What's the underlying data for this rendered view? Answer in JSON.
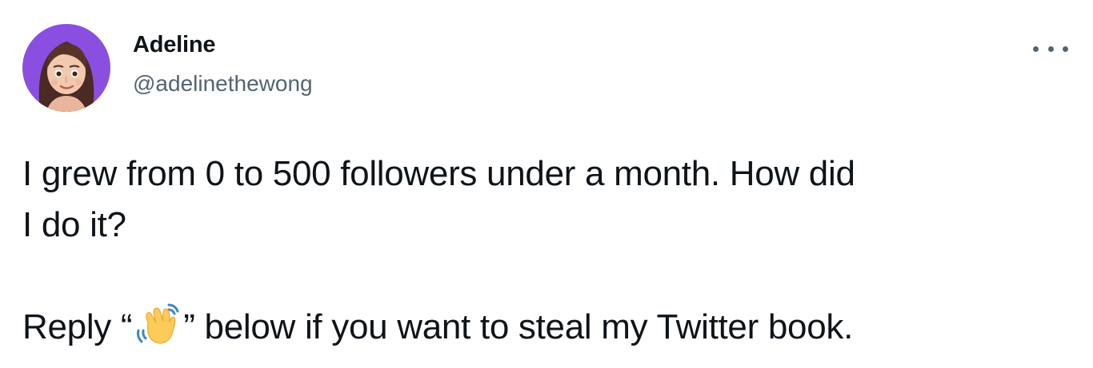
{
  "tweet": {
    "display_name": "Adeline",
    "handle": "@adelinethewong",
    "more_icon": "more-horizontal-icon",
    "text_line1": "I grew from 0 to 500 followers under a month. How did",
    "text_line2": "I do it?",
    "reply_prefix": "Reply “",
    "reply_emoji": "waving-hand-emoji",
    "reply_suffix": "” below if you want to steal my Twitter book.",
    "colors": {
      "text": "#0f1419",
      "secondary": "#536471",
      "avatar_bg": "#8a4fe0"
    }
  }
}
